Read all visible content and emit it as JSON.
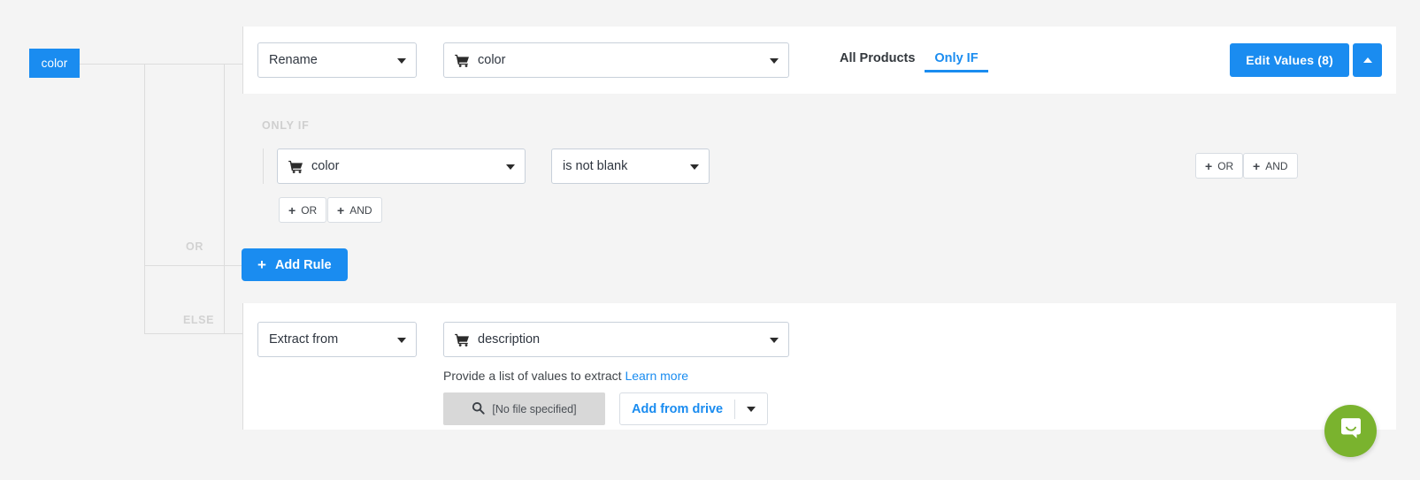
{
  "tree": {
    "field_badge": "color",
    "branch_or": "OR",
    "branch_else": "ELSE"
  },
  "rule_panel": {
    "action_select": "Rename",
    "field_select": "color",
    "field_icon": "shopping-cart-icon",
    "tabs": [
      {
        "label": "All Products",
        "active": false
      },
      {
        "label": "Only IF",
        "active": true
      }
    ],
    "edit_values_button": "Edit Values (8)",
    "collapse_icon": "chevron-up-icon"
  },
  "condition": {
    "section_label": "ONLY IF",
    "field_select": "color",
    "field_icon": "shopping-cart-icon",
    "operator_select": "is not blank",
    "inner_or_button": "OR",
    "inner_and_button": "AND",
    "outer_or_button": "OR",
    "outer_and_button": "AND",
    "plus_glyph": "+"
  },
  "add_rule_button": {
    "label": "Add Rule",
    "plus_glyph": "+"
  },
  "else_panel": {
    "action_select": "Extract from",
    "field_select": "description",
    "field_icon": "shopping-cart-icon",
    "help_text": "Provide a list of values to extract",
    "help_link": "Learn more",
    "file_input_value": "[No file specified]",
    "file_input_icon": "search-icon",
    "drive_button": "Add from drive",
    "drive_caret_icon": "chevron-down-icon"
  },
  "chat_widget": {
    "icon": "chat-bubble-icon",
    "color": "#7ab32e"
  },
  "colors": {
    "accent_blue": "#1a8cf0",
    "panel_bg": "#ffffff",
    "page_bg": "#f4f4f4",
    "tree_line": "#dcdcdc",
    "muted_label": "#d2d2d2"
  }
}
